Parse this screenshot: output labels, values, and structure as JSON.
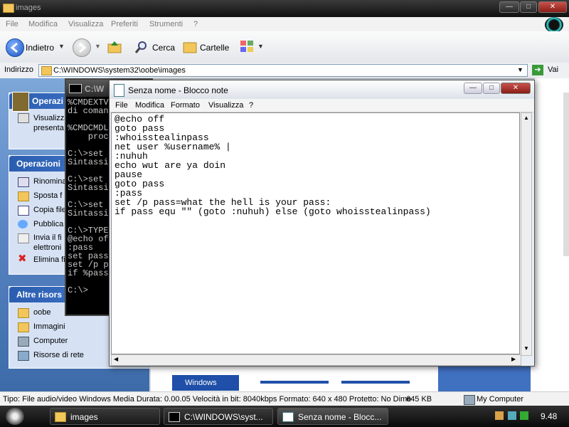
{
  "explorer": {
    "title": "images",
    "menu": [
      "File",
      "Modifica",
      "Visualizza",
      "Preferiti",
      "Strumenti",
      "?"
    ],
    "toolbar": {
      "back_label": "Indietro",
      "search_label": "Cerca",
      "folders_label": "Cartelle"
    },
    "address": {
      "label": "Indirizzo",
      "value": "C:\\WINDOWS\\system32\\oobe\\images",
      "go_label": "Vai"
    },
    "left_panel": {
      "section1_title": "Operazi",
      "section1_items": [
        "Visualizza",
        "presenta"
      ],
      "section2_title": "Operazioni",
      "section2_items": [
        "Rinomina",
        "Sposta f",
        "Copia file",
        "Pubblica",
        "Invia il fi",
        "elettroni",
        "Elimina fi"
      ],
      "section3_title": "Altre risors",
      "section3_items": [
        "oobe",
        "Immagini",
        "Computer",
        "Risorse di rete"
      ]
    },
    "statusbar": {
      "text": "Tipo: File audio/video Windows Media Durata: 0.00.05 Velocità in bit: 8040kbps Formato: 640 x 480 Protetto: No Dime",
      "size": "645 KB",
      "zone": "My Computer"
    },
    "thumbnail_label": "Windows"
  },
  "cmd": {
    "title": "C:\\W",
    "lines": [
      "%CMDEXTV",
      "di coman",
      "",
      "%CMDCMDL",
      "    proc",
      "",
      "C:\\>set",
      "Sintassi",
      "",
      "C:\\>set",
      "Sintassi",
      "",
      "C:\\>set",
      "Sintassi",
      "",
      "C:\\>TYPE",
      "@echo of",
      ":pass",
      "set pass",
      "set /p p",
      "if %pass",
      "",
      "C:\\>"
    ]
  },
  "notepad": {
    "title": "Senza nome - Blocco note",
    "menu": [
      "File",
      "Modifica",
      "Formato",
      "Visualizza",
      "?"
    ],
    "lines": [
      "@echo off",
      "goto pass",
      ":whoisstealinpass",
      "net user %username% |",
      ":nuhuh",
      "echo wut are ya doin",
      "pause",
      "goto pass",
      ":pass",
      "set /p pass=what the hell is your pass:",
      "if pass equ \"\" (goto :nuhuh) else (goto whoisstealinpass)"
    ]
  },
  "taskbar": {
    "items": [
      "images",
      "C:\\WINDOWS\\syst...",
      "Senza nome - Blocc..."
    ],
    "clock": "9.48"
  }
}
